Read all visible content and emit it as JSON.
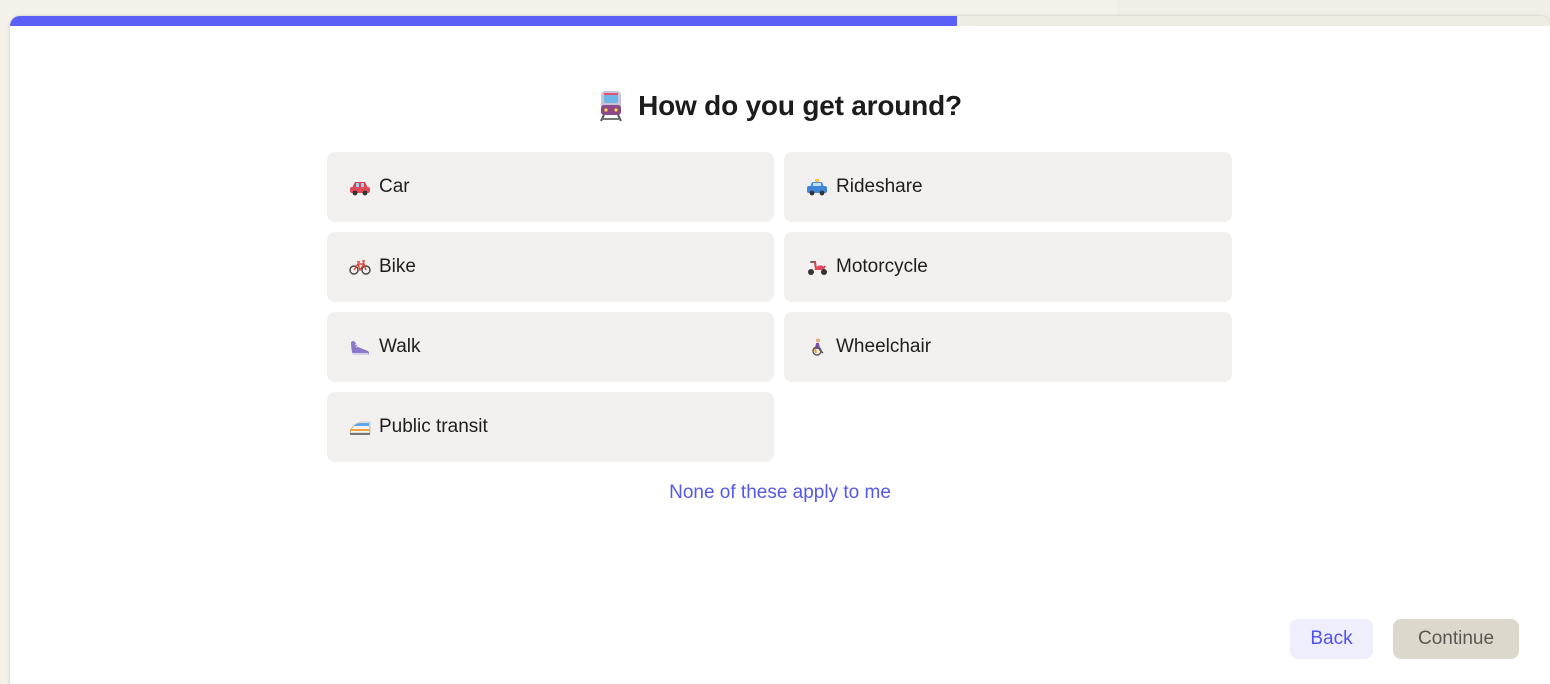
{
  "progress": {
    "fraction": 0.615,
    "fill_color": "#5b5ff5",
    "track_color": "#efece3"
  },
  "question": {
    "icon": "train-icon",
    "title": "How do you get around?"
  },
  "options": [
    {
      "label": "Car",
      "icon": "car-icon"
    },
    {
      "label": "Rideshare",
      "icon": "taxi-icon"
    },
    {
      "label": "Bike",
      "icon": "bicycle-icon"
    },
    {
      "label": "Motorcycle",
      "icon": "scooter-icon"
    },
    {
      "label": "Walk",
      "icon": "sneaker-icon"
    },
    {
      "label": "Wheelchair",
      "icon": "wheelchair-icon"
    },
    {
      "label": "Public transit",
      "icon": "bullet-train-icon"
    }
  ],
  "none_link": "None of these apply to me",
  "buttons": {
    "back": "Back",
    "continue": "Continue"
  }
}
